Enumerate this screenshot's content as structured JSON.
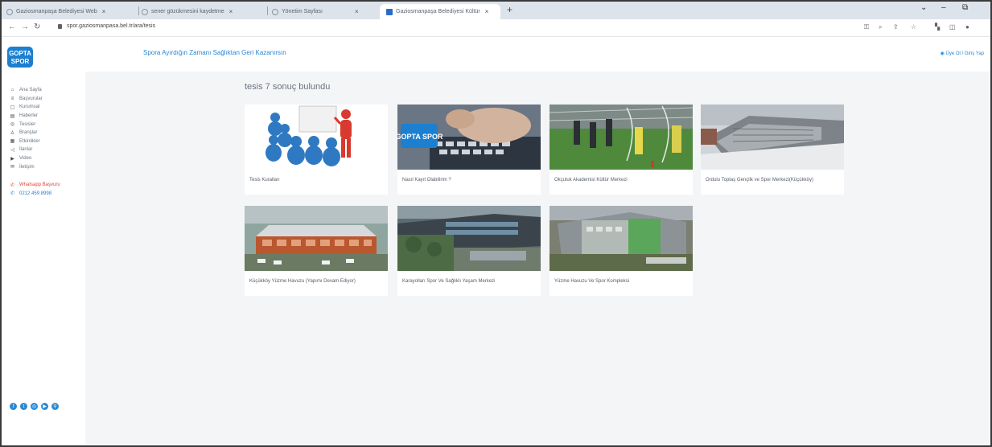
{
  "browser": {
    "tabs": [
      {
        "title": "Gaziosmanpaşa Belediyesi Web"
      },
      {
        "title": "sener gözükmesini kaydetme"
      },
      {
        "title": "Yönetim Sayfası"
      },
      {
        "title": "Gaziosmanpaşa Belediyesi Kültür"
      }
    ],
    "url": "spor.gaziosmanpasa.bel.tr/ara/tesis"
  },
  "app": {
    "logo_text": "GOPTA SPOR",
    "slogan": "Spora Ayırdığın Zamanı Sağlıktan Geri Kazanırsın",
    "header_link": "Üye Ol / Giriş Yap"
  },
  "sidebar": {
    "items": [
      {
        "label": "Ana Sayfa",
        "icon": "home-icon"
      },
      {
        "label": "Başvurular",
        "icon": "list-icon"
      },
      {
        "label": "Kurumsal",
        "icon": "building-icon"
      },
      {
        "label": "Haberler",
        "icon": "news-icon"
      },
      {
        "label": "Tesisler",
        "icon": "location-icon"
      },
      {
        "label": "Branşlar",
        "icon": "trophy-icon"
      },
      {
        "label": "Etkinlikler",
        "icon": "calendar-icon"
      },
      {
        "label": "İlanlar",
        "icon": "megaphone-icon"
      },
      {
        "label": "Video",
        "icon": "video-icon"
      },
      {
        "label": "İletişim",
        "icon": "mail-icon"
      }
    ],
    "whatsapp": "Whatsapp Başvuru",
    "phone": "0212 459 8998"
  },
  "results": {
    "title": "tesis 7 sonuç bulundu",
    "cards": [
      {
        "caption": "Tesis Kuralları"
      },
      {
        "caption": "Nasıl Kayıt Olabilirim ?"
      },
      {
        "caption": "Okçuluk Akademisi Kültür Merkezi"
      },
      {
        "caption": "Ordulu Toptaş Gençlik ve Spor Merkezi(Küçükköy)"
      },
      {
        "caption": "Küçükköy Yüzme Havuzu (Yapımı Devam Ediyor)"
      },
      {
        "caption": "Karayolları Spor Ve Sağlıklı Yaşam Merkezi"
      },
      {
        "caption": "Yüzme Havuzu Ve Spor Kompleksi"
      }
    ]
  },
  "colors": {
    "accent": "#2a86d4",
    "whatsapp": "#e0453c",
    "page_bg": "#f4f5f7"
  }
}
